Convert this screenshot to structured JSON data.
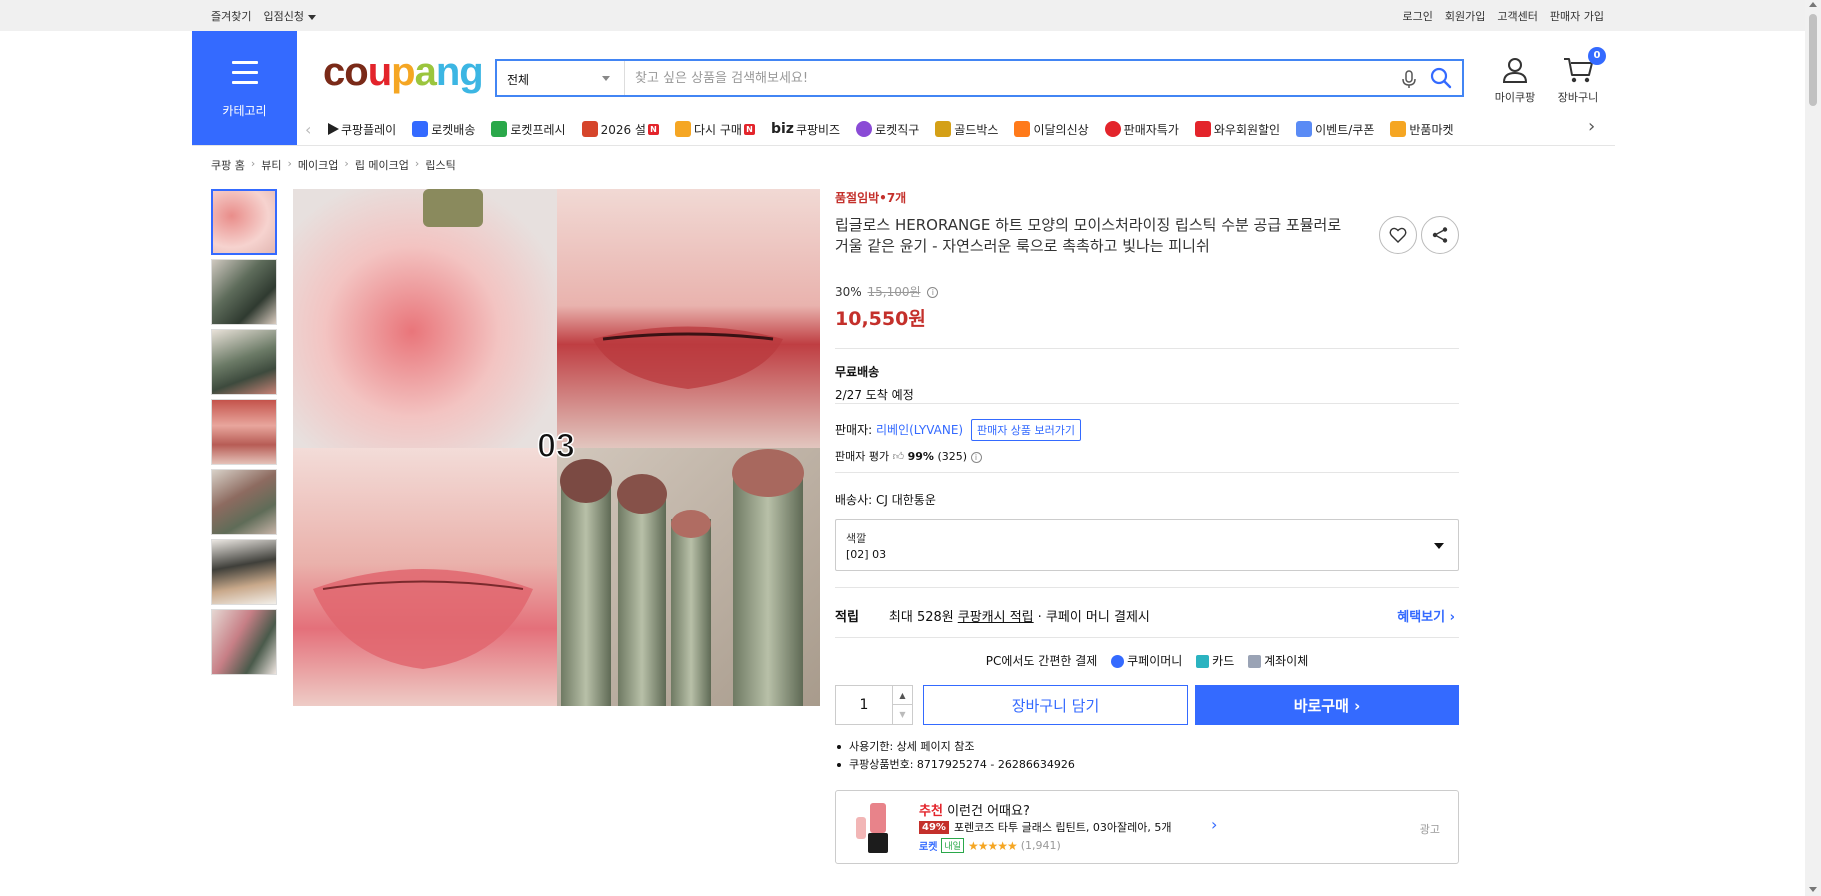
{
  "topbar": {
    "left": [
      "즐겨찾기",
      "입점신청"
    ],
    "right": [
      "로그인",
      "회원가입",
      "고객센터",
      "판매자 가입"
    ]
  },
  "category_label": "카테고리",
  "logo_letters": [
    "c",
    "o",
    "u",
    "p",
    "a",
    "n",
    "g"
  ],
  "search": {
    "category": "전체",
    "placeholder": "찾고 싶은 상품을 검색해보세요!"
  },
  "header_icons": {
    "mypage": "마이쿠팡",
    "cart": "장바구니",
    "cart_count": "0"
  },
  "nav_items": [
    {
      "label": "쿠팡플레이",
      "icon": "play-icon",
      "color": "#222222",
      "badge": ""
    },
    {
      "label": "로켓배송",
      "icon": "rocket-icon",
      "color": "#346aff",
      "badge": ""
    },
    {
      "label": "로켓프레시",
      "icon": "rocket-fresh-icon",
      "color": "#2aa84a",
      "badge": ""
    },
    {
      "label": "2026 설",
      "icon": "gift-icon",
      "color": "#d6452b",
      "badge": "N"
    },
    {
      "label": "다시 구매",
      "icon": "home-icon",
      "color": "#f5a623",
      "badge": "N"
    },
    {
      "label": "쿠팡비즈",
      "icon": "biz-icon",
      "color": "#333333",
      "badge": ""
    },
    {
      "label": "로켓직구",
      "icon": "global-icon",
      "color": "#8a4bd6",
      "badge": ""
    },
    {
      "label": "골드박스",
      "icon": "goldbox-icon",
      "color": "#d4a017",
      "badge": ""
    },
    {
      "label": "이달의신상",
      "icon": "bag-icon",
      "color": "#ff7a1a",
      "badge": ""
    },
    {
      "label": "판매자특가",
      "icon": "percent-icon",
      "color": "#e3242b",
      "badge": ""
    },
    {
      "label": "와우회원할인",
      "icon": "wow-icon",
      "color": "#e3242b",
      "badge": ""
    },
    {
      "label": "이벤트/쿠폰",
      "icon": "coupon-icon",
      "color": "#5a8bf5",
      "badge": ""
    },
    {
      "label": "반품마켓",
      "icon": "market-icon",
      "color": "#f5a623",
      "badge": ""
    }
  ],
  "nav_biz_prefix": "biz",
  "breadcrumb": [
    "쿠팡 홈",
    "뷰티",
    "메이크업",
    "립 메이크업",
    "립스틱"
  ],
  "product": {
    "stock_notice": "품절임박•7개",
    "title": "립글로스 HERORANGE 하트 모양의 모이스처라이징 립스틱 수분 공급 포뮬러로 거울 같은 윤기 - 자연스러운 룩으로 촉촉하고 빛나는 피니쉬",
    "discount_rate": "30%",
    "original_price": "15,100원",
    "price": "10,550원",
    "image_overlay_text": "03"
  },
  "shipping": {
    "title": "무료배송",
    "arrival": "2/27 도착 예정"
  },
  "seller": {
    "label": "판매자:",
    "name": "리베인(LYVANE)",
    "view_button": "판매자 상품 보러가기",
    "rating_label": "판매자 평가",
    "rating_pct": "99%",
    "rating_count": "(325)"
  },
  "carrier": "배송사:  CJ 대한통운",
  "option": {
    "title": "색깔",
    "value": "[02] 03"
  },
  "reward": {
    "label": "적립",
    "text_prefix": "최대 528원",
    "text_link": "쿠팡캐시 적립",
    "text_suffix": "· 쿠페이 머니 결제시",
    "more": "혜택보기 ›"
  },
  "pay": {
    "label": "PC에서도 간편한 결제",
    "methods": [
      "쿠페이머니",
      "카드",
      "계좌이체"
    ]
  },
  "purchase": {
    "qty": "1",
    "cart_button": "장바구니 담기",
    "buy_button": "바로구매 ›"
  },
  "bullets": [
    "사용기한: 상세 페이지 참조",
    "쿠팡상품번호: 8717925274 - 26286634926"
  ],
  "ad": {
    "rec": "추천",
    "headline": "이런건 어때요?",
    "pct": "49%",
    "product": "포렌코즈 타투 글래스 립틴트, 03아잘레아, 5개",
    "rocket": "로켓",
    "tomorrow": "내일",
    "stars": "★★★★★",
    "reviews": "(1,941)",
    "ad_label": "광고"
  },
  "colors": {
    "accent": "#346aff",
    "price_red": "#c4302b"
  }
}
